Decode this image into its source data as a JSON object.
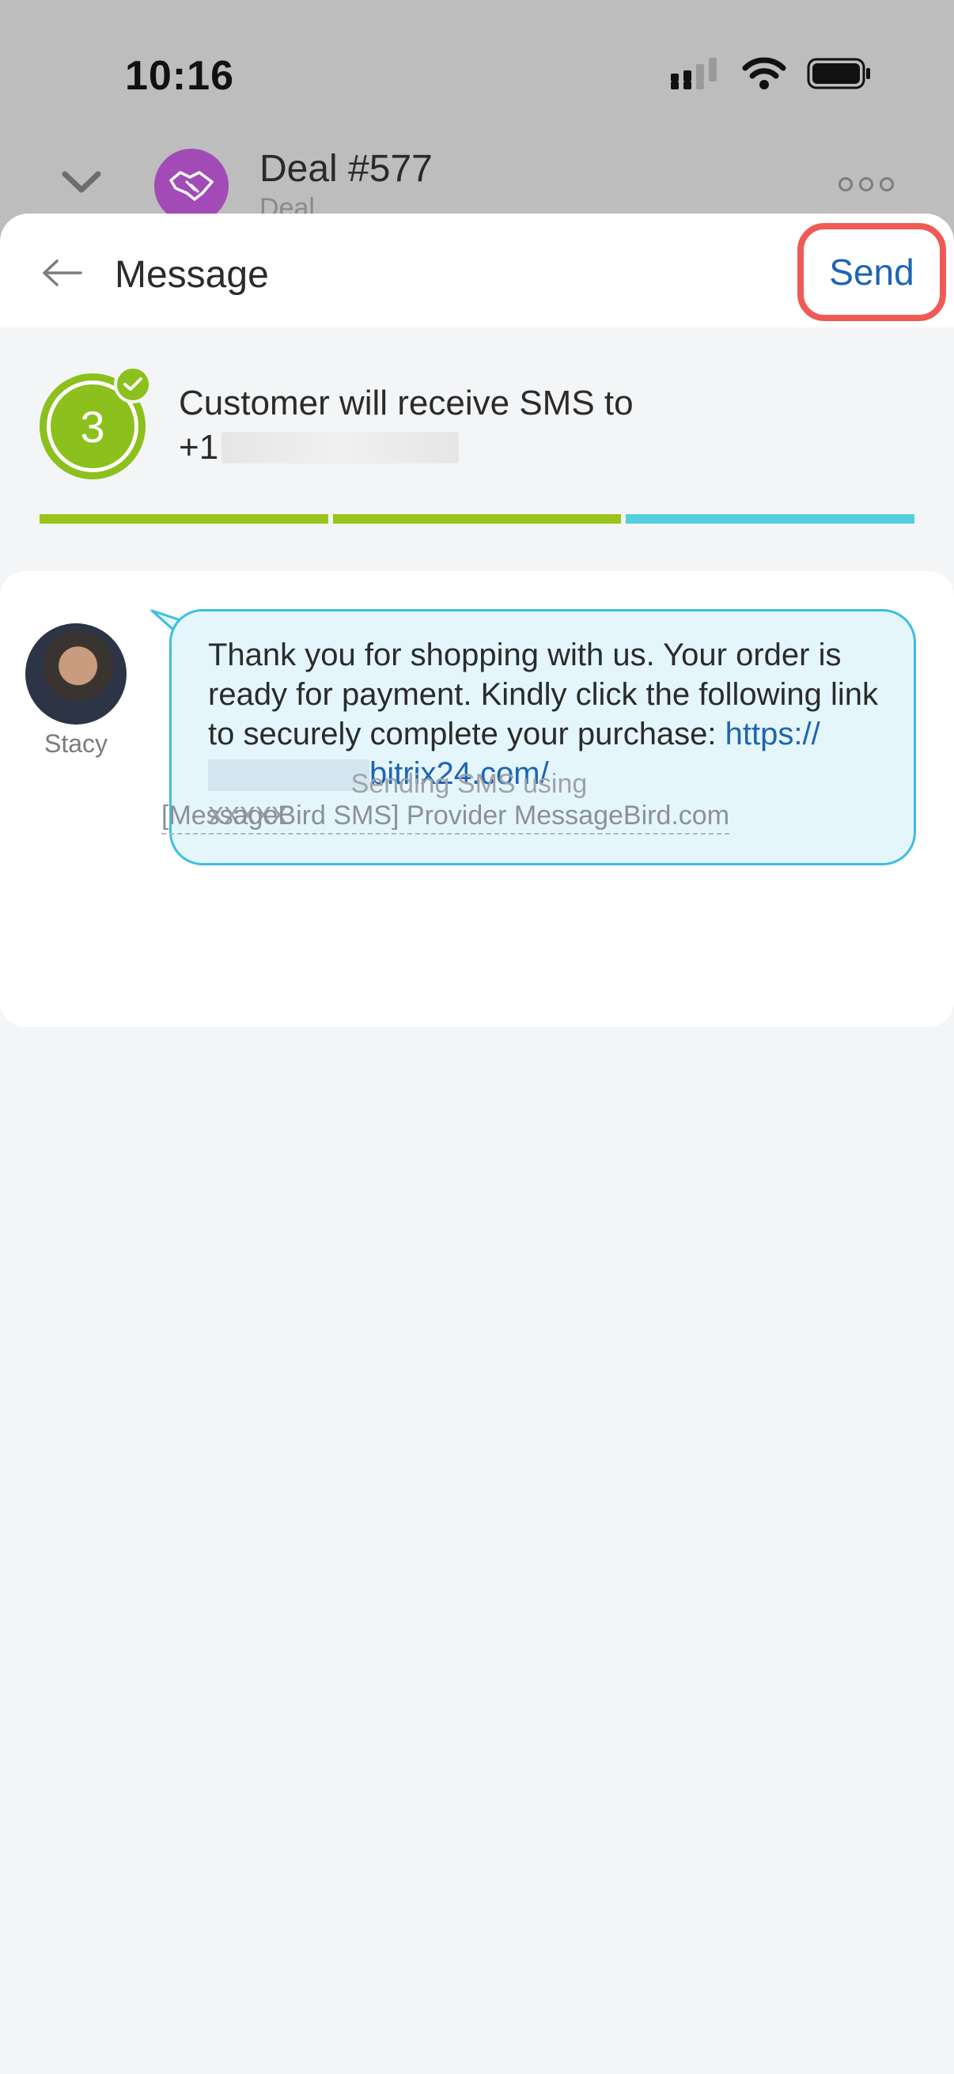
{
  "status_bar": {
    "time": "10:16"
  },
  "background_header": {
    "title": "Deal #577",
    "subtitle": "Deal"
  },
  "topbar": {
    "title": "Message",
    "send_label": "Send"
  },
  "step": {
    "number": "3",
    "text_line1": "Customer will receive SMS to",
    "phone_prefix": "+1",
    "progress_colors": [
      "#9bc41b",
      "#9bc41b",
      "#55cfe0"
    ]
  },
  "message": {
    "sender": "Stacy",
    "text": "Thank you for shopping with us. Your order is ready for payment. Kindly click the following link to securely complete your purchase: ",
    "link_start": "https://",
    "link_end": "bitrix24.com/",
    "link_tail": "xxxxx"
  },
  "provider": {
    "line1": "Sending SMS using",
    "line2": "[MessageBird SMS] Provider MessageBird.com"
  }
}
